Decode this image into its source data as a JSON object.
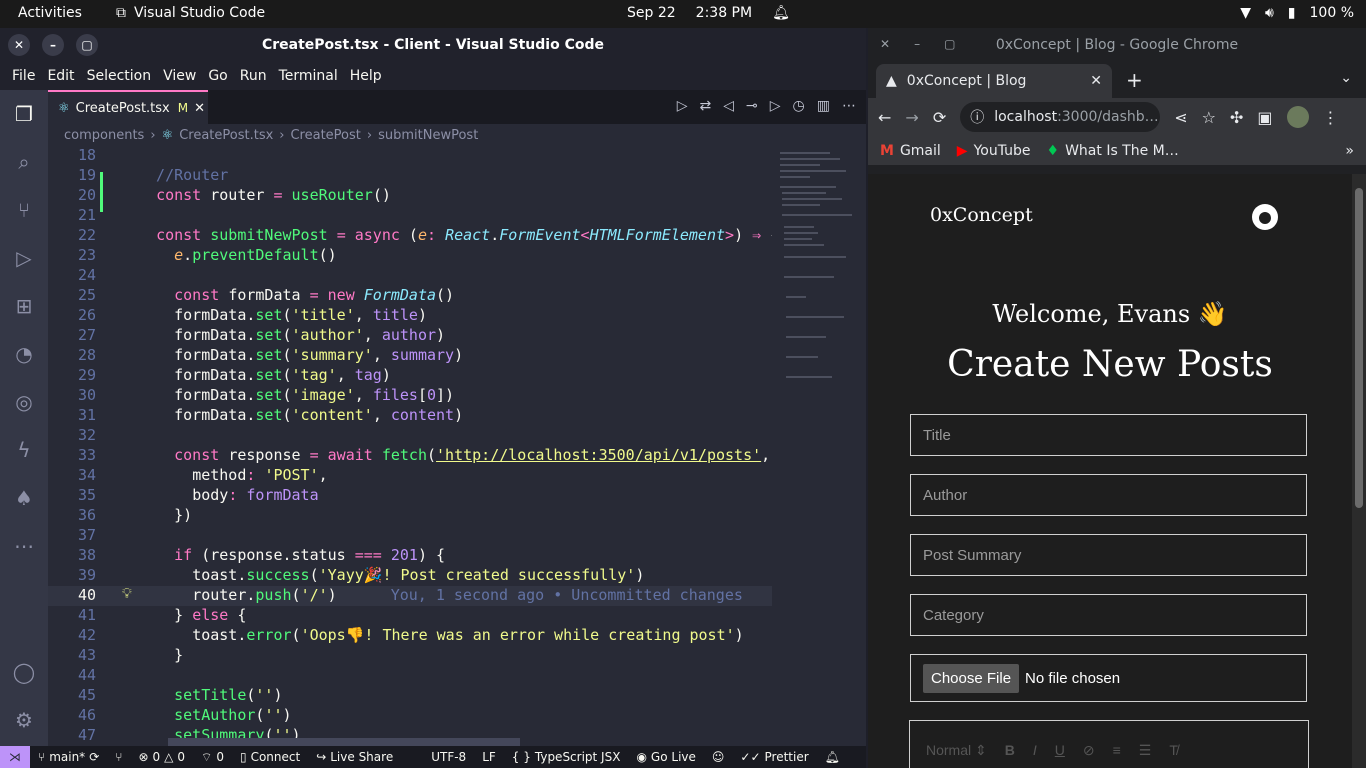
{
  "topbar": {
    "activities": "Activities",
    "app_name": "Visual Studio Code",
    "date": "Sep 22",
    "time": "2:38 PM",
    "battery": "100 %"
  },
  "vscode": {
    "window_title": "CreatePost.tsx - Client - Visual Studio Code",
    "menu": [
      "File",
      "Edit",
      "Selection",
      "View",
      "Go",
      "Run",
      "Terminal",
      "Help"
    ],
    "tab_label": "CreatePost.tsx",
    "tab_modified": "M",
    "breadcrumb": [
      "components",
      "CreatePost.tsx",
      "CreatePost",
      "submitNewPost"
    ],
    "blame": "You, 1 second ago • Uncommitted changes",
    "status": {
      "branch": "main*",
      "problems": "0",
      "warnings": "0",
      "ports": "0",
      "connect": "Connect",
      "live_share": "Live Share",
      "encoding": "UTF-8",
      "eol": "LF",
      "language": "TypeScript JSX",
      "go_live": "Go Live",
      "prettier": "Prettier"
    }
  },
  "chrome": {
    "window_title": "0xConcept | Blog - Google Chrome",
    "tab_title": "0xConcept | Blog",
    "url_host": "localhost",
    "url_rest": ":3000/dashb…",
    "bookmarks": [
      "Gmail",
      "YouTube",
      "What Is The M…"
    ],
    "page": {
      "logo": "0xConcept",
      "welcome": "Welcome, Evans 👋",
      "heading": "Create New Posts",
      "fields": [
        "Title",
        "Author",
        "Post Summary",
        "Category"
      ],
      "file_button": "Choose File",
      "file_status": "No file chosen",
      "editor_format": "Normal"
    }
  },
  "colors": {
    "accent": "#ff79c6",
    "git_added": "#50fa7b",
    "remote": "#bd93f9"
  }
}
